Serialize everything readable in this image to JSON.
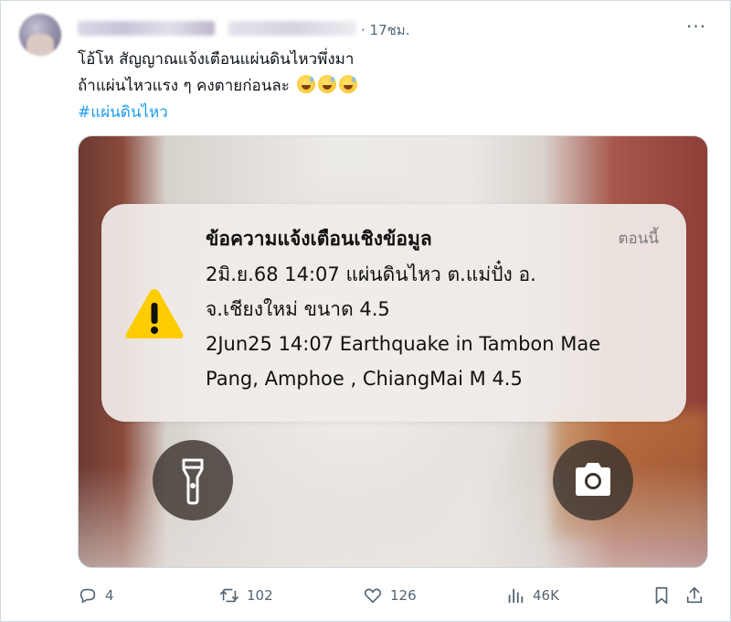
{
  "tweet": {
    "time": "· 17ชม.",
    "more_icon": "more-dots-icon",
    "text_lines": [
      "โอ้โห สัญญาณแจ้งเตือนแผ่นดินไหวพึ่งมา",
      "ถ้าแผ่นไหวแรง ๆ คงตายก่อนละ"
    ],
    "hashtag": "#แผ่นดินไหว",
    "emojis": [
      "grinning-sweat-emoji",
      "grinning-sweat-emoji",
      "grinning-sweat-emoji"
    ]
  },
  "alert": {
    "title": "ข้อความแจ้งเตือนเชิงข้อมูล",
    "time": "ตอนนี้",
    "body_lines": [
      "2มิ.ย.68 14:07 แผ่นดินไหว ต.แม่ปั๋ง อ.",
      "จ.เชียงใหม่ ขนาด 4.5",
      "2Jun25 14:07 Earthquake in Tambon Mae",
      "Pang, Amphoe , ChiangMai M 4.5"
    ],
    "icon": "warning-triangle-icon"
  },
  "lockscreen": {
    "left_button_icon": "flashlight-icon",
    "right_button_icon": "camera-icon"
  },
  "actions": {
    "reply_count": "4",
    "retweet_count": "102",
    "like_count": "126",
    "views_count": "46K"
  },
  "colors": {
    "accent": "#1d9bf0",
    "muted": "#536471",
    "warning": "#ffcc00"
  }
}
